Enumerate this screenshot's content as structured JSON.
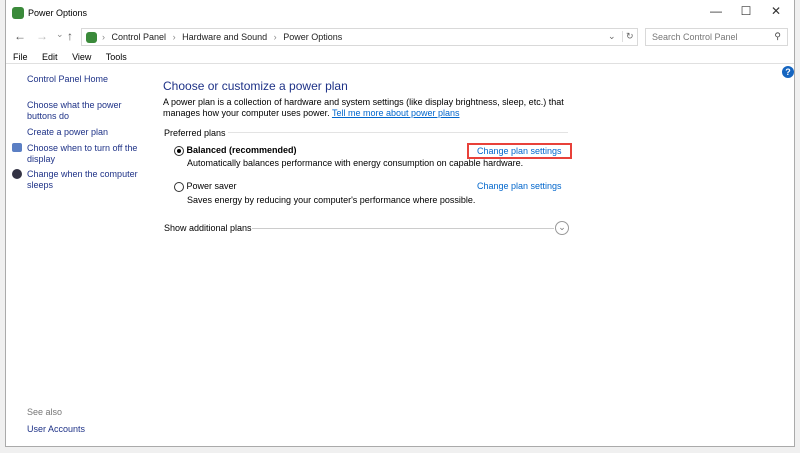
{
  "window": {
    "title": "Power Options",
    "minimize": "—",
    "maximize": "☐",
    "close": "✕"
  },
  "address": {
    "back": "←",
    "forward": "→",
    "recent": "⌄",
    "up": "↑",
    "crumbs": [
      "Control Panel",
      "Hardware and Sound",
      "Power Options"
    ],
    "sep": "›",
    "dropdown": "⌄",
    "refresh": "↻"
  },
  "search": {
    "placeholder": "Search Control Panel",
    "icon": "⚲"
  },
  "menu": [
    "File",
    "Edit",
    "View",
    "Tools"
  ],
  "help": "?",
  "sidebar": {
    "home": "Control Panel Home",
    "items": [
      "Choose what the power buttons do",
      "Create a power plan",
      "Choose when to turn off the display",
      "Change when the computer sleeps"
    ],
    "see_also": "See also",
    "user_accounts": "User Accounts"
  },
  "main": {
    "title": "Choose or customize a power plan",
    "desc": "A power plan is a collection of hardware and system settings (like display brightness, sleep, etc.) that manages how your computer uses power.",
    "desc_link": "Tell me more about power plans",
    "preferred": "Preferred plans",
    "plans": [
      {
        "name": "Balanced (recommended)",
        "desc": "Automatically balances performance with energy consumption on capable hardware.",
        "link": "Change plan settings",
        "selected": true
      },
      {
        "name": "Power saver",
        "desc": "Saves energy by reducing your computer's performance where possible.",
        "link": "Change plan settings",
        "selected": false
      }
    ],
    "show_more": "Show additional plans",
    "highlight_color": "#e8413a"
  }
}
